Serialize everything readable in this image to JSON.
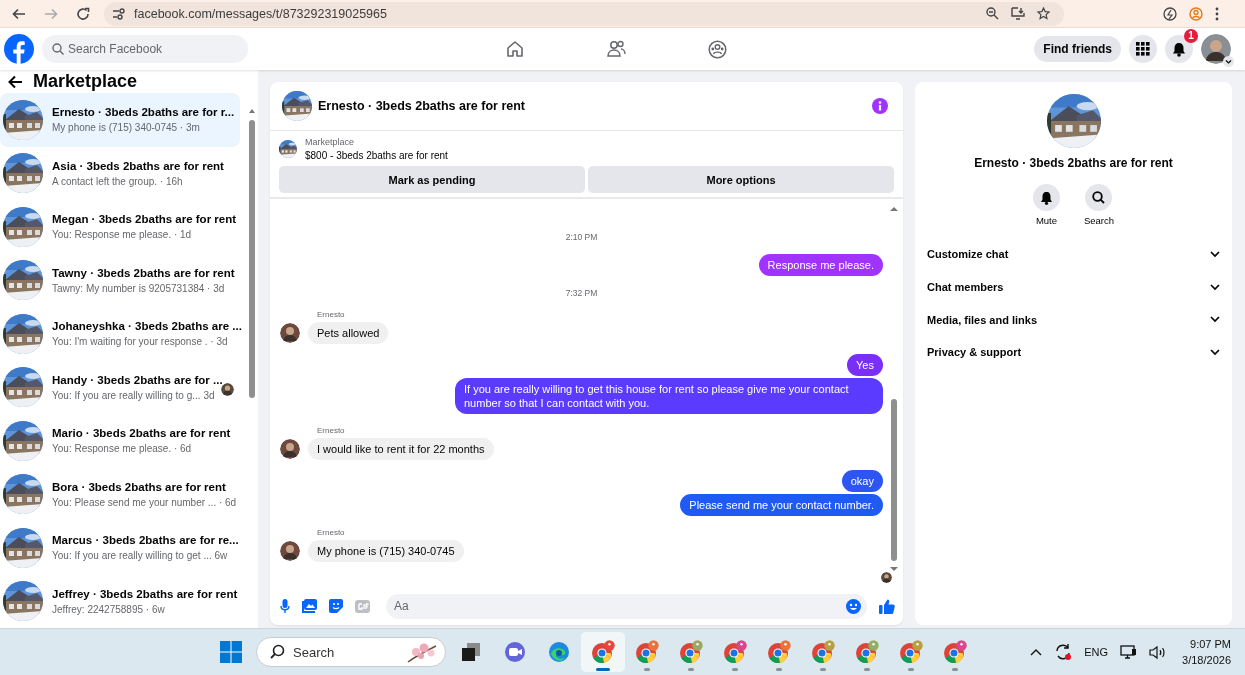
{
  "browser": {
    "url": "facebook.com/messages/t/873292319025965"
  },
  "header": {
    "search": {
      "placeholder": "Search Facebook"
    },
    "find_friends": "Find friends",
    "notification_count": "1"
  },
  "sidebar": {
    "title": "Marketplace",
    "conversations": [
      {
        "title": "Ernesto · 3beds 2baths are for r...",
        "preview": "My phone is (715) 340-0745 · 3m",
        "selected": true,
        "seen_avatar": false
      },
      {
        "title": "Asia · 3beds 2baths are for rent",
        "preview": "A contact left the group. · 16h",
        "selected": false,
        "seen_avatar": false
      },
      {
        "title": "Megan · 3beds 2baths are for rent",
        "preview": "You: Response me please. · 1d",
        "selected": false,
        "seen_avatar": false
      },
      {
        "title": "Tawny · 3beds 2baths are for rent",
        "preview": "Tawny: My number is 9205731384 · 3d",
        "selected": false,
        "seen_avatar": false
      },
      {
        "title": "Johaneyshka · 3beds 2baths are ...",
        "preview": "You: I'm waiting for your response . · 3d",
        "selected": false,
        "seen_avatar": false
      },
      {
        "title": "Handy · 3beds 2baths are for ...",
        "preview": "You: If you are really willing to g...  3d",
        "selected": false,
        "seen_avatar": true
      },
      {
        "title": "Mario · 3beds 2baths are for rent",
        "preview": "You: Response me please. · 6d",
        "selected": false,
        "seen_avatar": false
      },
      {
        "title": "Bora · 3beds 2baths are for rent",
        "preview": "You: Please send me your number ...  · 6d",
        "selected": false,
        "seen_avatar": false
      },
      {
        "title": "Marcus · 3beds 2baths are for re...",
        "preview": "You: If you are really willing to get ...  6w",
        "selected": false,
        "seen_avatar": false
      },
      {
        "title": "Jeffrey · 3beds 2baths are for rent",
        "preview": "Jeffrey: 2242758895 · 6w",
        "selected": false,
        "seen_avatar": false
      }
    ]
  },
  "chat": {
    "title": "Ernesto · 3beds 2baths are for rent",
    "listing": {
      "source": "Marketplace",
      "summary": "$800 - 3beds 2baths are for rent"
    },
    "actions": [
      "Mark as pending",
      "More options"
    ],
    "messages": [
      {
        "kind": "time",
        "text": "2:10 PM"
      },
      {
        "kind": "outgoing",
        "text": "Response me please.",
        "color": "#a033ff"
      },
      {
        "kind": "time",
        "text": "7:32 PM"
      },
      {
        "kind": "incoming",
        "sender": "Ernesto",
        "text": "Pets allowed"
      },
      {
        "kind": "outgoing",
        "text": "Yes",
        "color": "#7a2ff8"
      },
      {
        "kind": "outgoing",
        "text": "If you are really willing to get this house for rent so please give me your contact number so that I  can contact with you.",
        "color": "#5b3bff"
      },
      {
        "kind": "incoming",
        "sender": "Ernesto",
        "text": "I would like to rent it for 22 months"
      },
      {
        "kind": "outgoing",
        "text": "okay",
        "color": "#2c55f2"
      },
      {
        "kind": "outgoing",
        "text": "Please send me your contact number.",
        "color": "#1f5af5"
      },
      {
        "kind": "incoming",
        "sender": "Ernesto",
        "text": "My phone is (715) 340-0745"
      }
    ],
    "composer": {
      "placeholder": "Aa"
    }
  },
  "info": {
    "name": "Ernesto · 3beds 2baths are for rent",
    "actions": [
      {
        "kind": "mute",
        "label": "Mute"
      },
      {
        "kind": "search",
        "label": "Search"
      }
    ],
    "sections": [
      "Customize chat",
      "Chat members",
      "Media, files and links",
      "Privacy & support"
    ]
  },
  "taskbar": {
    "search": {
      "placeholder": "Search"
    },
    "apps": [
      {
        "kind": "taskview",
        "running": false,
        "selected": false
      },
      {
        "kind": "meet",
        "running": false,
        "selected": false
      },
      {
        "kind": "edge",
        "running": false,
        "selected": false
      },
      {
        "kind": "chrome",
        "running": true,
        "selected": true,
        "color": "#e8453c"
      },
      {
        "kind": "chrome",
        "running": true,
        "selected": false,
        "color": "#e8743c"
      },
      {
        "kind": "chrome",
        "running": true,
        "selected": false,
        "color": "#9aa860"
      },
      {
        "kind": "chrome",
        "running": true,
        "selected": false,
        "color": "#d9468a"
      },
      {
        "kind": "chrome",
        "running": true,
        "selected": false,
        "color": "#e8743c"
      },
      {
        "kind": "chrome",
        "running": true,
        "selected": false,
        "color": "#b8a040"
      },
      {
        "kind": "chrome",
        "running": true,
        "selected": false,
        "color": "#8fb060"
      },
      {
        "kind": "chrome",
        "running": true,
        "selected": false,
        "color": "#b8a040"
      },
      {
        "kind": "chrome",
        "running": true,
        "selected": false,
        "color": "#d9468a"
      }
    ],
    "language": "ENG",
    "time": "9:07 PM",
    "date": "3/18/2026"
  }
}
